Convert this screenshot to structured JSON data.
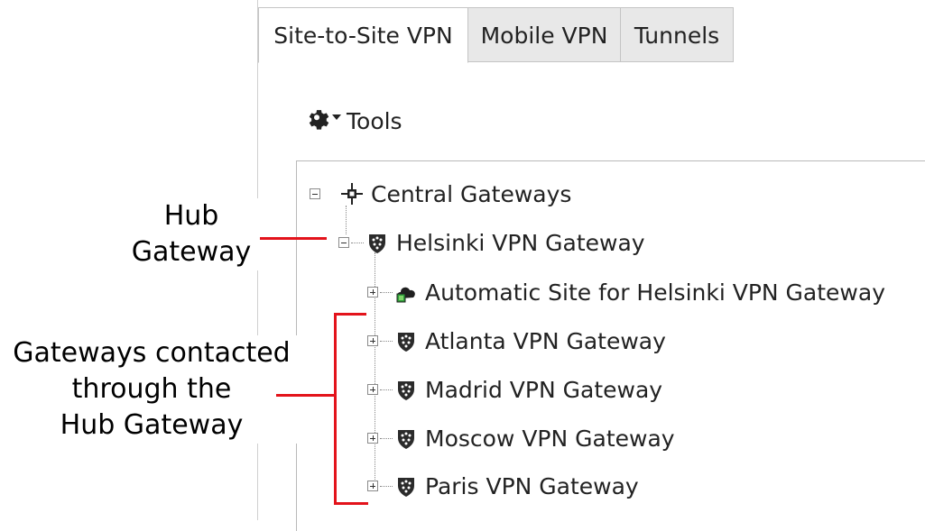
{
  "tabs": [
    {
      "label": "Site-to-Site VPN",
      "active": true
    },
    {
      "label": "Mobile VPN",
      "active": false
    },
    {
      "label": "Tunnels",
      "active": false
    }
  ],
  "toolbar": {
    "tools_label": "Tools",
    "icon": "gear-icon"
  },
  "tree": {
    "root": {
      "label": "Central Gateways",
      "icon": "central-gateways-icon",
      "expanded": true
    },
    "hub": {
      "label": "Helsinki VPN Gateway",
      "icon": "shield-gateway-icon",
      "expanded": true
    },
    "children": [
      {
        "label": "Automatic Site for Helsinki VPN Gateway",
        "icon": "site-cloud-icon",
        "expanded": false
      },
      {
        "label": "Atlanta VPN Gateway",
        "icon": "shield-gateway-icon",
        "expanded": false
      },
      {
        "label": "Madrid VPN Gateway",
        "icon": "shield-gateway-icon",
        "expanded": false
      },
      {
        "label": "Moscow VPN Gateway",
        "icon": "shield-gateway-icon",
        "expanded": false
      },
      {
        "label": "Paris VPN Gateway",
        "icon": "shield-gateway-icon",
        "expanded": false
      }
    ]
  },
  "annotations": {
    "hub_line1": "Hub",
    "hub_line2": "Gateway",
    "contacted_line1": "Gateways contacted",
    "contacted_line2": "through the",
    "contacted_line3": "Hub Gateway",
    "callout_color": "#e3131b"
  }
}
